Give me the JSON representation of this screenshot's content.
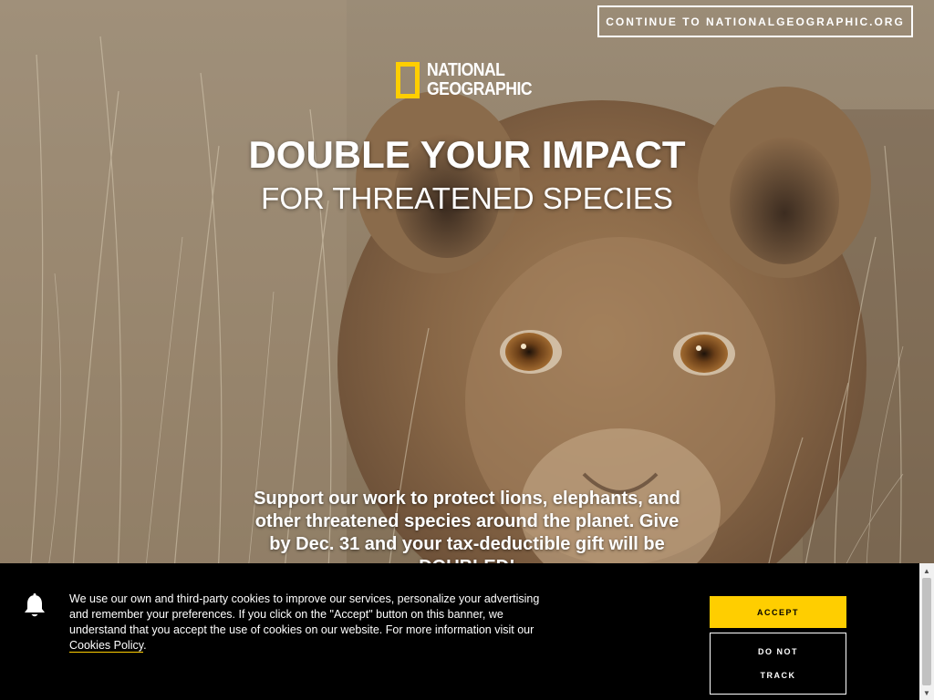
{
  "nav": {
    "continue_label": "CONTINUE TO NATIONALGEOGRAPHIC.ORG"
  },
  "logo": {
    "line1": "NATIONAL",
    "line2": "GEOGRAPHIC",
    "brand_color": "#ffce00"
  },
  "hero": {
    "headline": "DOUBLE YOUR IMPACT",
    "subheadline": "FOR THREATENED SPECIES",
    "body_line1": "Support our work to protect lions, elephants, and",
    "body_line2": "other threatened species around the planet. Give",
    "body_line3": "by Dec. 31 and your tax-deductible gift will be",
    "body_line4": "DOUBLED!"
  },
  "cookie_banner": {
    "icon": "bell-icon",
    "text_line1": "We use our own and third-party cookies to improve our services, personalize your advertising",
    "text_line2": "and remember your preferences. If you click on the \"Accept\" button on this banner, we",
    "text_line3": "understand that you accept the use of cookies on our website. For more information visit our",
    "policy_link": "Cookies Policy",
    "policy_suffix": ".",
    "accept_label": "ACCEPT",
    "dnt_label_line1": "DO NOT",
    "dnt_label_line2": "TRACK"
  },
  "scrollbar": {
    "up_icon": "scroll-up-arrow-icon",
    "down_icon": "scroll-down-arrow-icon"
  },
  "colors": {
    "accent": "#ffce00",
    "banner_bg": "#000000",
    "text": "#ffffff"
  }
}
